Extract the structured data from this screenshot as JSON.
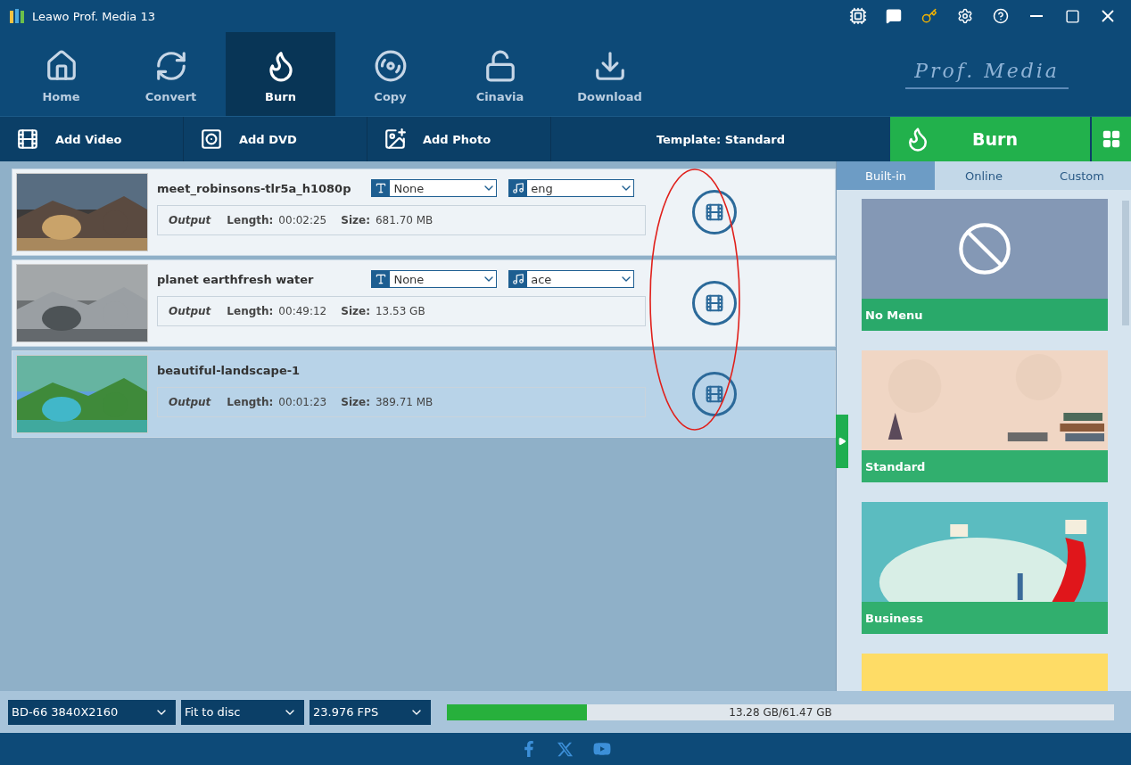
{
  "window": {
    "title": "Leawo Prof. Media 13"
  },
  "nav": [
    {
      "label": "Home",
      "selected": false
    },
    {
      "label": "Convert",
      "selected": false
    },
    {
      "label": "Burn",
      "selected": true
    },
    {
      "label": "Copy",
      "selected": false
    },
    {
      "label": "Cinavia",
      "selected": false
    },
    {
      "label": "Download",
      "selected": false
    }
  ],
  "logo": "Prof. Media",
  "toolbar": {
    "buttons": [
      "Add Video",
      "Add DVD",
      "Add Photo"
    ],
    "template": "Template: Standard",
    "burn": "Burn"
  },
  "videos": [
    {
      "title": "meet_robinsons-tlr5a_h1080p",
      "subtitle": "None",
      "audio": "eng",
      "output": "Output",
      "length_label": "Length:",
      "length": "00:02:25",
      "size_label": "Size:",
      "size": "681.70 MB",
      "selected": false
    },
    {
      "title": "planet earthfresh water",
      "subtitle": "None",
      "audio": "ace",
      "output": "Output",
      "length_label": "Length:",
      "length": "00:49:12",
      "size_label": "Size:",
      "size": "13.53 GB",
      "selected": false
    },
    {
      "title": "beautiful-landscape-1",
      "output": "Output",
      "length_label": "Length:",
      "length": "00:01:23",
      "size_label": "Size:",
      "size": "389.71 MB",
      "selected": true
    }
  ],
  "template_tabs": [
    {
      "label": "Built-in",
      "selected": true
    },
    {
      "label": "Online",
      "selected": false
    },
    {
      "label": "Custom",
      "selected": false
    }
  ],
  "templates": [
    {
      "kind": "none",
      "label": "No Menu"
    },
    {
      "kind": "standard",
      "label": "Standard"
    },
    {
      "kind": "business",
      "label": "Business"
    },
    {
      "kind": "yellow"
    }
  ],
  "bottom": {
    "selects": [
      "BD-66 3840X2160",
      "Fit to disc",
      "23.976 FPS"
    ],
    "disc": {
      "level": 0.21,
      "reading": "13.28 GB/61.47 GB"
    }
  }
}
